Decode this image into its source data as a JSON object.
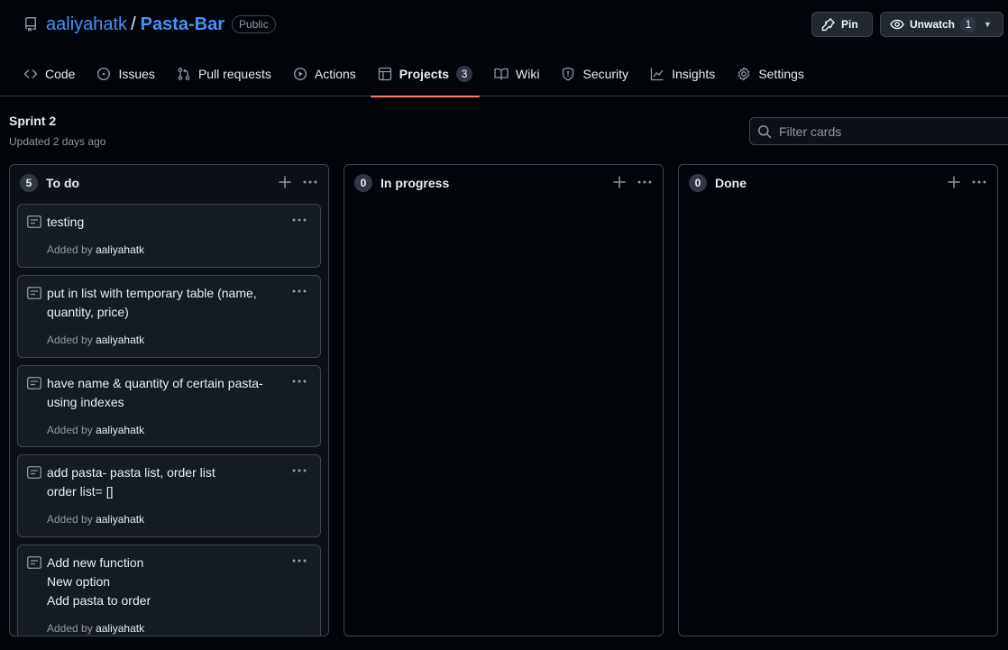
{
  "repo": {
    "owner": "aaliyahatk",
    "separator": "/",
    "name": "Pasta-Bar",
    "visibility": "Public"
  },
  "actions": {
    "pin_label": "Pin",
    "watch_label": "Unwatch",
    "watch_count": "1"
  },
  "nav": {
    "items": [
      {
        "label": "Code",
        "icon": "code-icon"
      },
      {
        "label": "Issues",
        "icon": "issue-opened-icon"
      },
      {
        "label": "Pull requests",
        "icon": "git-pull-request-icon"
      },
      {
        "label": "Actions",
        "icon": "play-icon"
      },
      {
        "label": "Projects",
        "icon": "table-icon",
        "count": "3",
        "selected": true
      },
      {
        "label": "Wiki",
        "icon": "book-icon"
      },
      {
        "label": "Security",
        "icon": "shield-icon"
      },
      {
        "label": "Insights",
        "icon": "graph-icon"
      },
      {
        "label": "Settings",
        "icon": "gear-icon"
      }
    ]
  },
  "project": {
    "name": "Sprint 2",
    "updated": "Updated 2 days ago",
    "filter_placeholder": "Filter cards"
  },
  "columns": [
    {
      "title": "To do",
      "count": "5",
      "cards": [
        {
          "title": "testing",
          "added_by_prefix": "Added by",
          "author": "aaliyahatk"
        },
        {
          "title": "put in list with temporary table (name,\nquantity, price)",
          "added_by_prefix": "Added by",
          "author": "aaliyahatk"
        },
        {
          "title": "have name & quantity of certain pasta-\nusing indexes",
          "added_by_prefix": "Added by",
          "author": "aaliyahatk"
        },
        {
          "title": "add pasta- pasta list, order list\norder list= []",
          "added_by_prefix": "Added by",
          "author": "aaliyahatk"
        },
        {
          "title": "Add new function\nNew option\nAdd pasta to order",
          "added_by_prefix": "Added by",
          "author": "aaliyahatk"
        }
      ]
    },
    {
      "title": "In progress",
      "count": "0",
      "cards": []
    },
    {
      "title": "Done",
      "count": "0",
      "cards": []
    }
  ],
  "colors": {
    "link": "#4493f8",
    "selected_tab_underline": "#f78166",
    "background": "#010409",
    "card_background": "#151b23"
  }
}
